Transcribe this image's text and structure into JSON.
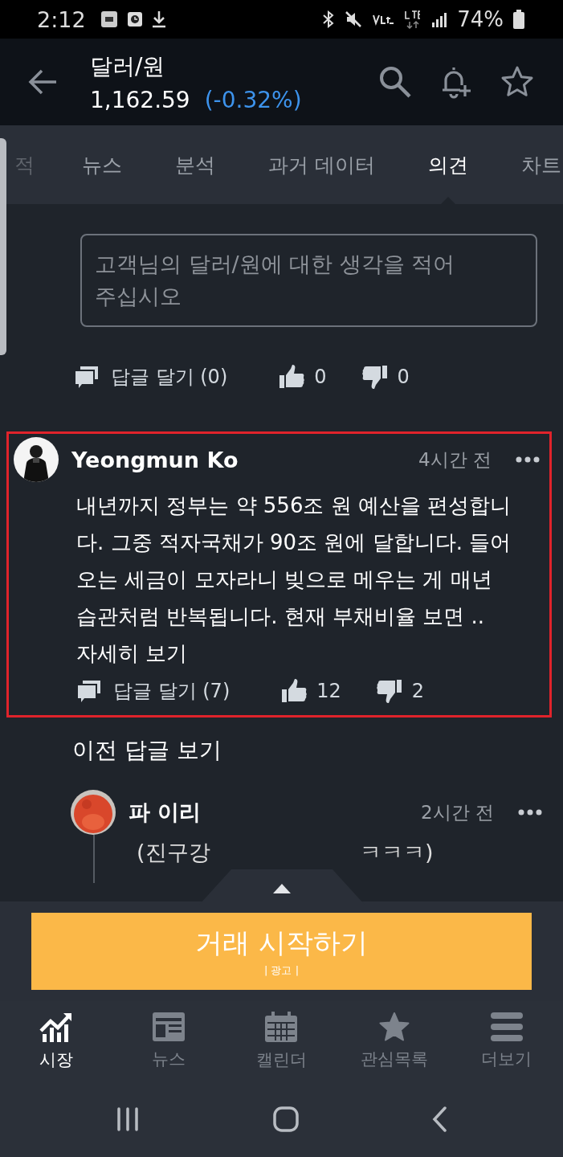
{
  "status_bar": {
    "time": "2:12",
    "battery": "74%"
  },
  "header": {
    "title": "달러/원",
    "price": "1,162.59",
    "change": "(-0.32%)"
  },
  "tabs": [
    {
      "label": "적",
      "selected": false
    },
    {
      "label": "뉴스",
      "selected": false
    },
    {
      "label": "분석",
      "selected": false
    },
    {
      "label": "과거 데이터",
      "selected": false
    },
    {
      "label": "의견",
      "selected": true
    },
    {
      "label": "차트",
      "selected": false
    }
  ],
  "comment_input": {
    "placeholder": "고객님의 달러/원에 대한 생각을 적어 주십시오"
  },
  "prev_actions": {
    "reply": "답글 달기 (0)",
    "likes": "0",
    "dislikes": "0"
  },
  "comment": {
    "author": "Yeongmun Ko",
    "time": "4시간 전",
    "text": "내년까지 정부는 약 556조 원 예산을 편성합니다. 그중 적자국채가 90조 원에 달합니다. 들어오는 세금이 모자라니 빚으로 메우는 게 매년 습관처럼 반복됩니다. 현재 부채비율 보면 ..",
    "more": "자세히 보기",
    "reply": "답글 달기 (7)",
    "likes": "12",
    "dislikes": "2",
    "highlighted": true
  },
  "previous_replies": "이전 답글 보기",
  "reply": {
    "author": "파 이리",
    "time": "2시간 전",
    "text_start": "(진구강",
    "text_end": "ㅋㅋㅋ)"
  },
  "cta": {
    "label": "거래 시작하기",
    "ad": "| 광고 |"
  },
  "bottom_nav": [
    {
      "label": "시장",
      "selected": true,
      "kind": "chart"
    },
    {
      "label": "뉴스",
      "selected": false,
      "kind": "news"
    },
    {
      "label": "캘린더",
      "selected": false,
      "kind": "calendar"
    },
    {
      "label": "관심목록",
      "selected": false,
      "kind": "star"
    },
    {
      "label": "더보기",
      "selected": false,
      "kind": "menu"
    }
  ]
}
